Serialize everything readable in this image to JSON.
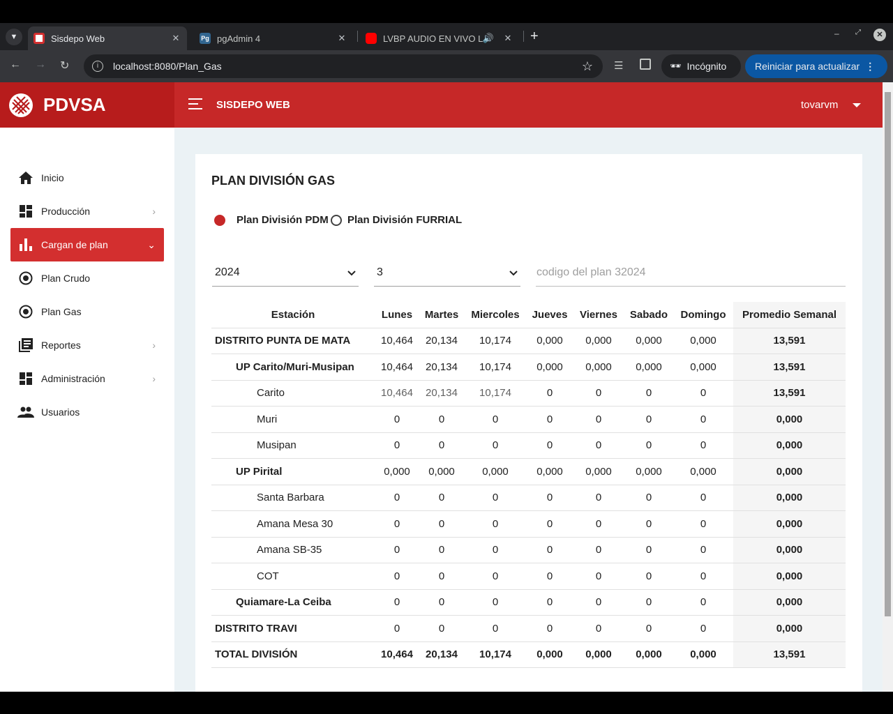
{
  "browser": {
    "tabs": [
      {
        "title": "Sisdepo Web",
        "active": true
      },
      {
        "title": "pgAdmin 4",
        "active": false
      },
      {
        "title": "LVBP AUDIO EN VIVO Lec",
        "active": false
      }
    ],
    "url": "localhost:8080/Plan_Gas",
    "incognito_label": "Incógnito",
    "update_label": "Reiniciar para actualizar"
  },
  "header": {
    "brand": "PDVSA",
    "app_title": "SISDEPO WEB",
    "user": "tovarvm"
  },
  "sidebar": {
    "items": [
      {
        "label": "Inicio",
        "icon": "home-icon"
      },
      {
        "label": "Producción",
        "icon": "dashboard-icon",
        "chevron": "right"
      },
      {
        "label": "Cargan de plan",
        "icon": "bar-chart-icon",
        "chevron": "down",
        "active": true
      },
      {
        "label": "Plan Crudo",
        "icon": "radio-target-icon"
      },
      {
        "label": "Plan Gas",
        "icon": "radio-target-icon"
      },
      {
        "label": "Reportes",
        "icon": "library-books-icon",
        "chevron": "right"
      },
      {
        "label": "Administración",
        "icon": "dashboard-icon",
        "chevron": "right"
      },
      {
        "label": "Usuarios",
        "icon": "people-icon"
      }
    ]
  },
  "main": {
    "title": "PLAN DIVISIÓN GAS",
    "radios": [
      {
        "label": "Plan División PDM",
        "selected": true
      },
      {
        "label": "Plan División FURRIAL",
        "selected": false
      }
    ],
    "year_select": "2024",
    "month_select": "3",
    "codigo_placeholder": "codigo del plan 32024",
    "table": {
      "headers": [
        "Estación",
        "Lunes",
        "Martes",
        "Miercoles",
        "Jueves",
        "Viernes",
        "Sabado",
        "Domingo",
        "Promedio Semanal"
      ],
      "rows": [
        {
          "level": 0,
          "cells": [
            "DISTRITO PUNTA DE MATA",
            "10,464",
            "20,134",
            "10,174",
            "0,000",
            "0,000",
            "0,000",
            "0,000",
            "13,591"
          ]
        },
        {
          "level": 1,
          "cells": [
            "UP Carito/Muri-Musipan",
            "10,464",
            "20,134",
            "10,174",
            "0,000",
            "0,000",
            "0,000",
            "0,000",
            "13,591"
          ]
        },
        {
          "level": 2,
          "cells": [
            "Carito",
            "10,464",
            "20,134",
            "10,174",
            "0",
            "0",
            "0",
            "0",
            "13,591"
          ]
        },
        {
          "level": 2,
          "cells": [
            "Muri",
            "0",
            "0",
            "0",
            "0",
            "0",
            "0",
            "0",
            "0,000"
          ]
        },
        {
          "level": 2,
          "cells": [
            "Musipan",
            "0",
            "0",
            "0",
            "0",
            "0",
            "0",
            "0",
            "0,000"
          ]
        },
        {
          "level": 1,
          "cells": [
            "UP Pirital",
            "0,000",
            "0,000",
            "0,000",
            "0,000",
            "0,000",
            "0,000",
            "0,000",
            "0,000"
          ]
        },
        {
          "level": 2,
          "cells": [
            "Santa Barbara",
            "0",
            "0",
            "0",
            "0",
            "0",
            "0",
            "0",
            "0,000"
          ]
        },
        {
          "level": 2,
          "cells": [
            "Amana Mesa 30",
            "0",
            "0",
            "0",
            "0",
            "0",
            "0",
            "0",
            "0,000"
          ]
        },
        {
          "level": 2,
          "cells": [
            "Amana SB-35",
            "0",
            "0",
            "0",
            "0",
            "0",
            "0",
            "0",
            "0,000"
          ]
        },
        {
          "level": 2,
          "cells": [
            "COT",
            "0",
            "0",
            "0",
            "0",
            "0",
            "0",
            "0",
            "0,000"
          ]
        },
        {
          "level": 1,
          "cells": [
            "Quiamare-La Ceiba",
            "0",
            "0",
            "0",
            "0",
            "0",
            "0",
            "0",
            "0,000"
          ]
        },
        {
          "level": 0,
          "cells": [
            "DISTRITO TRAVI",
            "0",
            "0",
            "0",
            "0",
            "0",
            "0",
            "0",
            "0,000"
          ]
        },
        {
          "level": 0,
          "total": true,
          "cells": [
            "TOTAL DIVISIÓN",
            "10,464",
            "20,134",
            "10,174",
            "0,000",
            "0,000",
            "0,000",
            "0,000",
            "13,591"
          ]
        }
      ]
    }
  },
  "colors": {
    "header_red": "#c62828",
    "brand_red": "#b71c1c",
    "active_nav": "#d32f2f",
    "page_bg": "#ebf2f5"
  }
}
